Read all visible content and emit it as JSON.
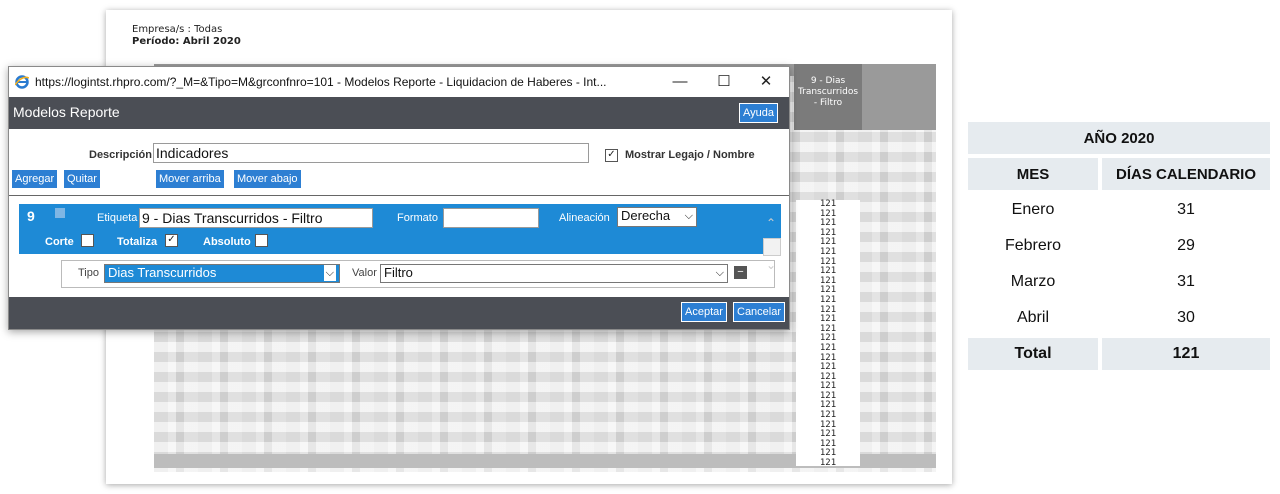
{
  "report": {
    "empresa_line": "Empresa/s : Todas",
    "periodo_line": "Período: Abril 2020",
    "column_header": [
      "9 - Dias",
      "Transcurridos",
      "- Filtro"
    ],
    "column_values": [
      "121",
      "121",
      "121",
      "121",
      "121",
      "121",
      "121",
      "121",
      "121",
      "121",
      "121",
      "121",
      "121",
      "121",
      "121",
      "121",
      "121",
      "121",
      "121",
      "121",
      "121",
      "121",
      "121",
      "121",
      "121",
      "121",
      "121",
      "121"
    ]
  },
  "window": {
    "url": "https://logintst.rhpro.com/?_M=&Tipo=M&grconfnro=101 - Modelos Reporte - Liquidacion de Haberes - Int...",
    "minimize": "—",
    "maximize": "☐",
    "close": "✕"
  },
  "dialog": {
    "title": "Modelos Reporte",
    "help_label": "Ayuda",
    "descripcion_label": "Descripción:",
    "descripcion_value": "Indicadores",
    "mostrar_legajo_label": "Mostrar Legajo / Nombre",
    "mostrar_legajo_checked": "✓",
    "agregar_label": "Agregar",
    "quitar_label": "Quitar",
    "mover_arriba_label": "Mover arriba",
    "mover_abajo_label": "Mover abajo",
    "item_number": "9",
    "etiqueta_label": "Etiqueta",
    "etiqueta_value": "9 - Dias Transcurridos - Filtro",
    "formato_label": "Formato",
    "formato_value": "",
    "alineacion_label": "Alineación",
    "alineacion_value": "Derecha",
    "corte_label": "Corte",
    "totaliza_label": "Totaliza",
    "totaliza_checked": "✓",
    "absoluto_label": "Absoluto",
    "tipo_label": "Tipo",
    "tipo_value": "Dias Transcurridos",
    "valor_label": "Valor",
    "valor_value": "Filtro",
    "aceptar_label": "Aceptar",
    "cancelar_label": "Cancelar"
  },
  "calendar_table": {
    "title": "AÑO 2020",
    "col_mes": "MES",
    "col_dias": "DÍAS CALENDARIO",
    "rows": [
      {
        "mes": "Enero",
        "dias": "31"
      },
      {
        "mes": "Febrero",
        "dias": "29"
      },
      {
        "mes": "Marzo",
        "dias": "31"
      },
      {
        "mes": "Abril",
        "dias": "30"
      }
    ],
    "total_label": "Total",
    "total_value": "121"
  },
  "colors": {
    "accent_blue": "#1e8ad6",
    "button_blue": "#2d7fd3",
    "header_dark": "#4b4e55",
    "table_shade": "#e6ebef"
  }
}
